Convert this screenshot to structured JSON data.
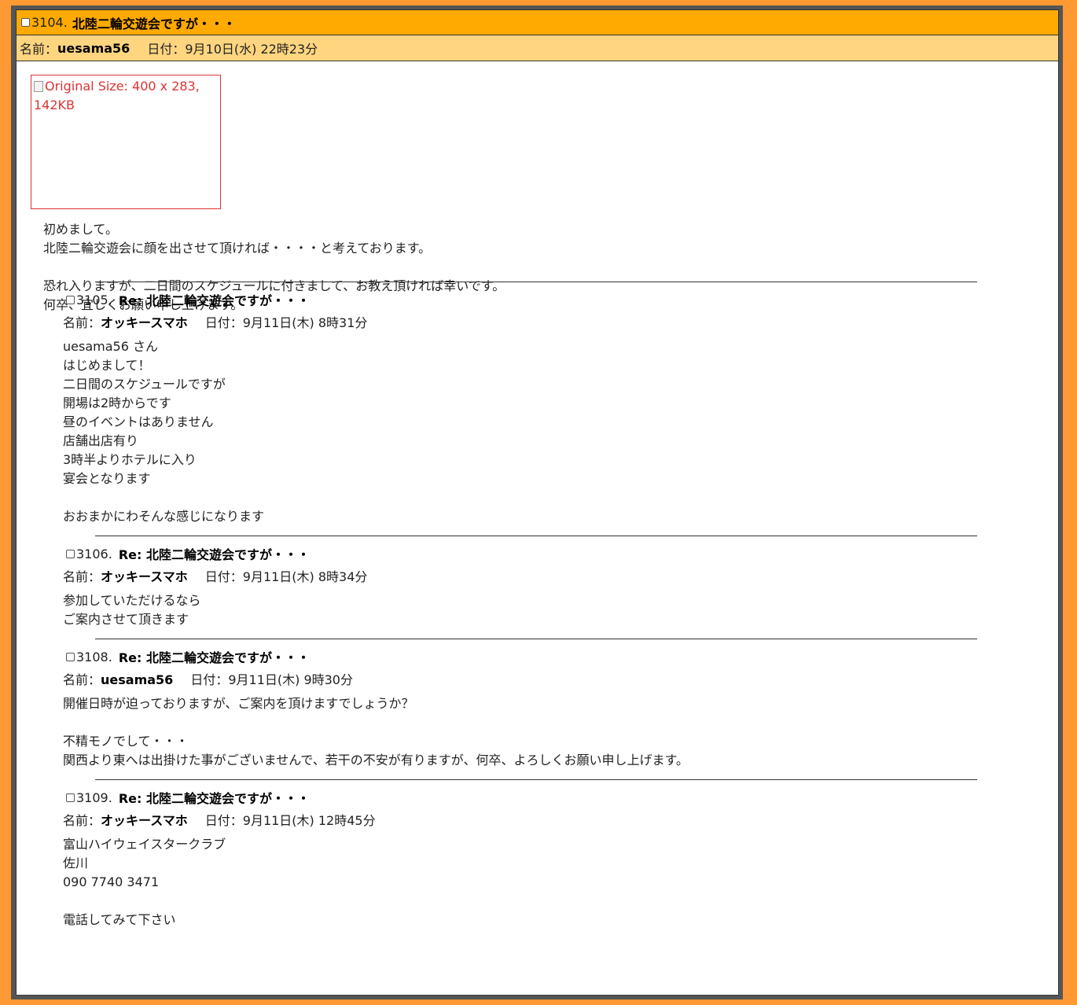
{
  "post": {
    "number": "3104.",
    "subject": "北陸二輪交遊会ですが・・・",
    "name_label": "名前：",
    "name": "uesama56",
    "date_label": "日付：",
    "date": "9月10日(水) 22時23分",
    "image_alt": "Original Size: 400 x 283, 142KB",
    "body": "初めまして。\n北陸二輪交遊会に顔を出させて頂ければ・・・・と考えております。\n\n恐れ入りますが、二日間のスケジュールに付きまして、お教え頂ければ幸いです。\n何卒、宜しくお願い申し上げます。"
  },
  "replies": [
    {
      "number": "3105.",
      "subject": "Re: 北陸二輪交遊会ですが・・・",
      "name_label": "名前：",
      "name": "オッキースマホ",
      "date_label": "日付：",
      "date": "9月11日(木) 8時31分",
      "body": "uesama56 さん\nはじめまして！\n二日間のスケジュールですが\n開場は2時からです\n昼のイベントはありません\n店舗出店有り\n3時半よりホテルに入り\n宴会となります\n\nおおまかにわそんな感じになります"
    },
    {
      "number": "3106.",
      "subject": "Re: 北陸二輪交遊会ですが・・・",
      "name_label": "名前：",
      "name": "オッキースマホ",
      "date_label": "日付：",
      "date": "9月11日(木) 8時34分",
      "body": "参加していただけるなら\nご案内させて頂きます"
    },
    {
      "number": "3108.",
      "subject": "Re: 北陸二輪交遊会ですが・・・",
      "name_label": "名前：",
      "name": "uesama56",
      "date_label": "日付：",
      "date": "9月11日(木) 9時30分",
      "body": "開催日時が迫っておりますが、ご案内を頂けますでしょうか？\n\n不精モノでして・・・\n関西より東へは出掛けた事がございませんで、若干の不安が有りますが、何卒、よろしくお願い申し上げます。"
    },
    {
      "number": "3109.",
      "subject": "Re: 北陸二輪交遊会ですが・・・",
      "name_label": "名前：",
      "name": "オッキースマホ",
      "date_label": "日付：",
      "date": "9月11日(木) 12時45分",
      "body": "富山ハイウェイスタークラブ\n佐川\n090 7740 3471\n\n電話してみて下さい"
    }
  ],
  "colors": {
    "page_bg": "#ff9933",
    "title_bar": "#ffaa00",
    "meta_bar": "#ffd580",
    "broken_image_text": "#dd3333"
  }
}
